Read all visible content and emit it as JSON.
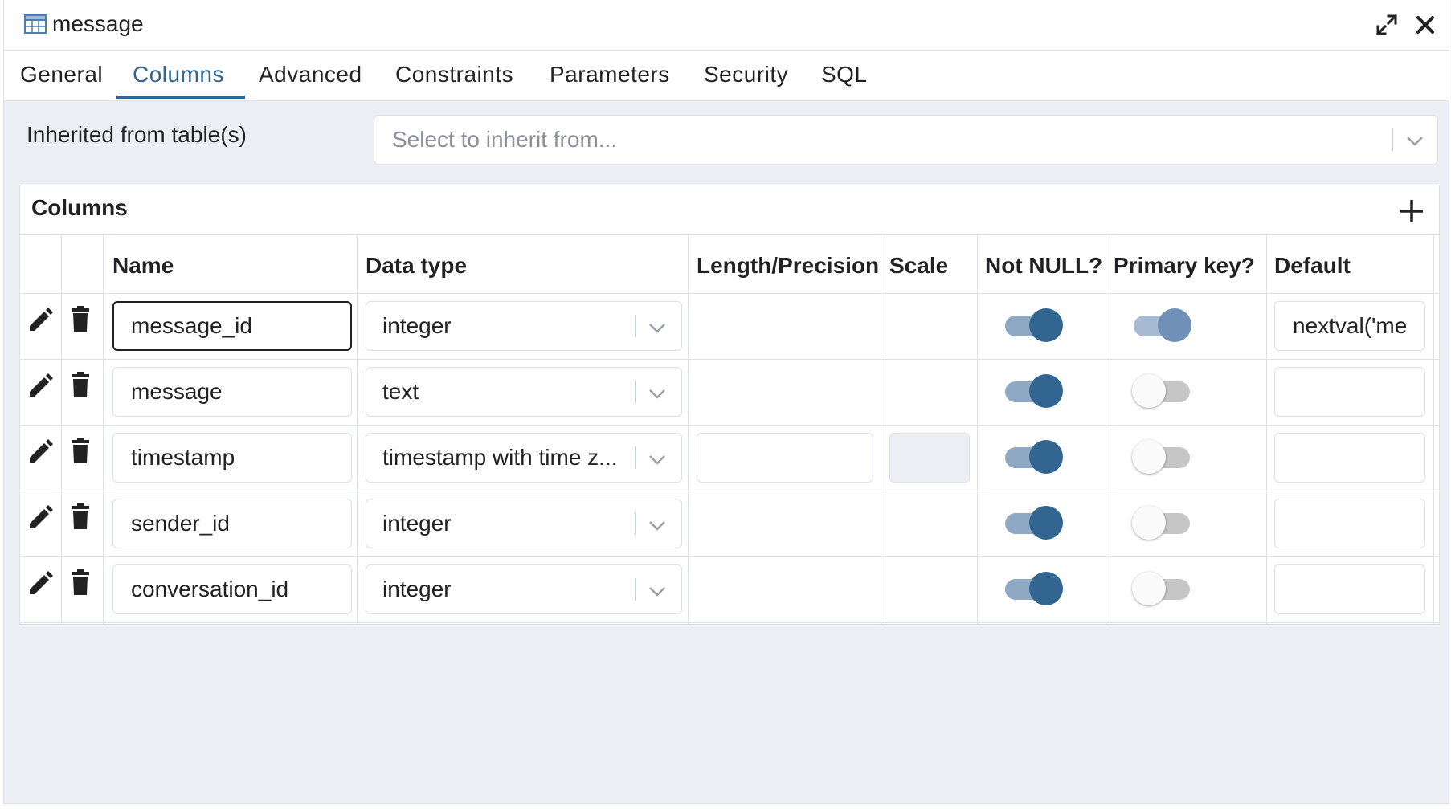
{
  "window": {
    "title": "message",
    "icon": "table-icon",
    "maximize_icon": "maximize-icon",
    "close_icon": "close-icon"
  },
  "tabs": [
    {
      "label": "General",
      "active": false
    },
    {
      "label": "Columns",
      "active": true
    },
    {
      "label": "Advanced",
      "active": false
    },
    {
      "label": "Constraints",
      "active": false
    },
    {
      "label": "Parameters",
      "active": false
    },
    {
      "label": "Security",
      "active": false
    },
    {
      "label": "SQL",
      "active": false
    }
  ],
  "inherit": {
    "label": "Inherited from table(s)",
    "placeholder": "Select to inherit from..."
  },
  "columns_panel": {
    "title": "Columns",
    "add_icon": "plus-icon",
    "headers": {
      "name": "Name",
      "data_type": "Data type",
      "length": "Length/Precision",
      "scale": "Scale",
      "not_null": "Not NULL?",
      "primary_key": "Primary key?",
      "default": "Default"
    },
    "rows": [
      {
        "name": "message_id",
        "data_type": "integer",
        "length": "",
        "scale": "",
        "not_null": true,
        "primary_key": true,
        "default": "nextval('me"
      },
      {
        "name": "message",
        "data_type": "text",
        "length": "",
        "scale": "",
        "not_null": true,
        "primary_key": false,
        "default": ""
      },
      {
        "name": "timestamp",
        "data_type": "timestamp with time z...",
        "length": "",
        "scale": "",
        "not_null": true,
        "primary_key": false,
        "default": ""
      },
      {
        "name": "sender_id",
        "data_type": "integer",
        "length": "",
        "scale": "",
        "not_null": true,
        "primary_key": false,
        "default": ""
      },
      {
        "name": "conversation_id",
        "data_type": "integer",
        "length": "",
        "scale": "",
        "not_null": true,
        "primary_key": false,
        "default": ""
      }
    ]
  },
  "colors": {
    "accent": "#326690",
    "toggle_track_on": "#8fa8c3",
    "toggle_off_track": "#c6c6c6",
    "background": "#ebeef3"
  }
}
